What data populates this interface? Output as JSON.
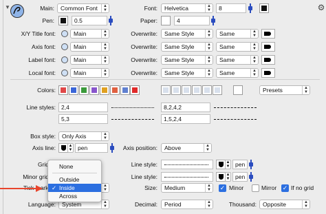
{
  "colors": {
    "accent": "#2c6fe0",
    "arrow": "#e8452c",
    "palette": [
      "#e04848",
      "#3a66d8",
      "#3a9a3a",
      "#8855cc",
      "#e0a020",
      "#e06040",
      "#6080d0"
    ],
    "selected_color": "#e02a2a"
  },
  "icons": {
    "gear": "gear-icon",
    "disclosure": "disclosure-triangle-icon",
    "font": "font-icon",
    "pen": "pen-icon"
  },
  "main": {
    "main_label": "Main:",
    "main_value": "Common Font",
    "font_label": "Font:",
    "font_value": "Helvetica",
    "size_value": "8",
    "pen_label": "Pen:",
    "pen_value": "0.5",
    "paper_label": "Paper:",
    "paper_value": "4"
  },
  "fonts": [
    {
      "label": "X/Y Title font:",
      "value": "Main",
      "overwrite_label": "Overwrite:",
      "style": "Same Style",
      "size": "Same"
    },
    {
      "label": "Axis font:",
      "value": "Main",
      "overwrite_label": "Overwrite:",
      "style": "Same Style",
      "size": "Same"
    },
    {
      "label": "Label font:",
      "value": "Main",
      "overwrite_label": "Overwrite:",
      "style": "Same Style",
      "size": "Same"
    },
    {
      "label": "Local font:",
      "value": "Main",
      "overwrite_label": "Overwrite:",
      "style": "Same Style",
      "size": "Same"
    }
  ],
  "colors_row": {
    "label": "Colors:",
    "presets": "Presets"
  },
  "line_styles": {
    "label": "Line styles:",
    "a": "2,4",
    "b": "8,2,4,2",
    "c": "5,3",
    "d": "1,5,2,4"
  },
  "box_style": {
    "label": "Box style:",
    "value": "Only Axis"
  },
  "axis_line": {
    "label": "Axis line:",
    "pen": "pen",
    "position_label": "Axis position:",
    "position_value": "Above"
  },
  "grid": {
    "label": "Grid",
    "line_style_label": "Line style:",
    "pen": "pen"
  },
  "minor_grid": {
    "label": "Minor grid",
    "line_style_label": "Line style:",
    "pen": "pen"
  },
  "tick_marks": {
    "label": "Tick marks:",
    "size_label": "Size:",
    "size_value": "Medium",
    "minor": "Minor",
    "mirror": "Mirror",
    "if_no_grid": "If no grid"
  },
  "language": {
    "label": "Language:",
    "value": "System",
    "decimal_label": "Decimal:",
    "decimal_value": "Period",
    "thousand_label": "Thousand:",
    "thousand_value": "Opposite"
  },
  "menu": {
    "items": [
      "None",
      "Outside",
      "Inside",
      "Across"
    ],
    "selected": "Inside",
    "checkmark": "✓"
  }
}
